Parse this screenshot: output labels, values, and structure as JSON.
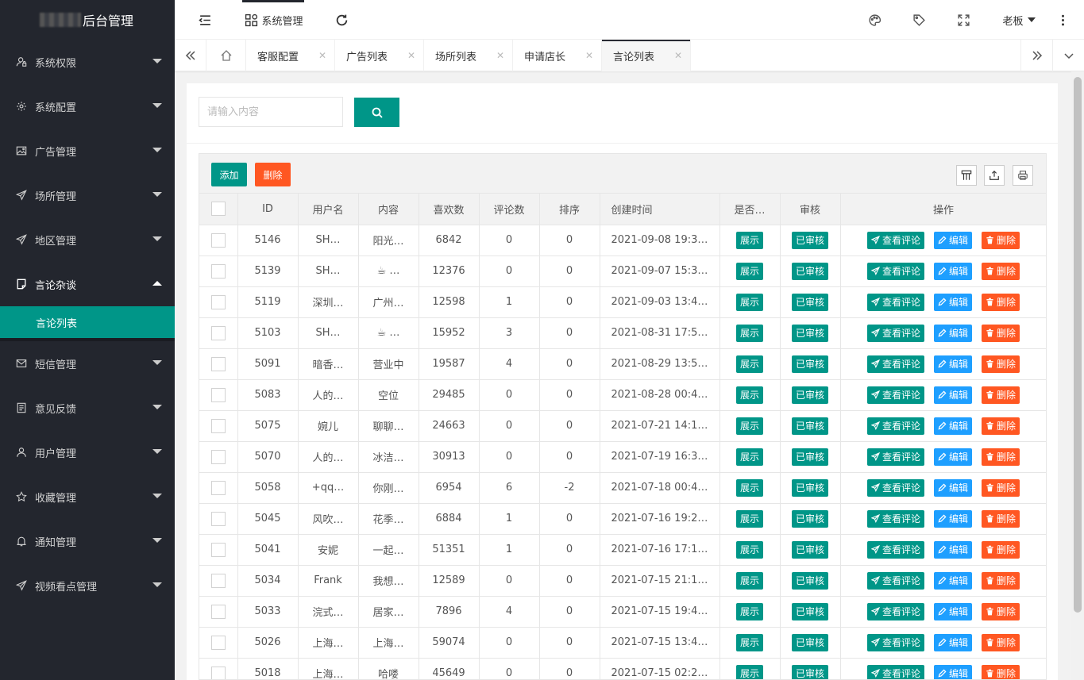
{
  "brand": {
    "title": "后台管理"
  },
  "sidebar": {
    "items": [
      {
        "label": "系统权限",
        "icon": "user-lock-icon"
      },
      {
        "label": "系统配置",
        "icon": "gear-icon"
      },
      {
        "label": "广告管理",
        "icon": "image-icon"
      },
      {
        "label": "场所管理",
        "icon": "send-icon"
      },
      {
        "label": "地区管理",
        "icon": "send-icon"
      },
      {
        "label": "言论杂谈",
        "icon": "note-icon",
        "open": true,
        "sub": [
          {
            "label": "言论列表",
            "active": true
          }
        ]
      },
      {
        "label": "短信管理",
        "icon": "mail-icon"
      },
      {
        "label": "意见反馈",
        "icon": "list-icon"
      },
      {
        "label": "用户管理",
        "icon": "user-icon"
      },
      {
        "label": "收藏管理",
        "icon": "star-icon"
      },
      {
        "label": "通知管理",
        "icon": "bell-icon"
      },
      {
        "label": "视频看点管理",
        "icon": "send-icon"
      }
    ]
  },
  "header": {
    "system_label": "系统管理",
    "user_label": "老板"
  },
  "tabs": [
    {
      "label": "客服配置"
    },
    {
      "label": "广告列表"
    },
    {
      "label": "场所列表"
    },
    {
      "label": "申请店长"
    },
    {
      "label": "言论列表",
      "active": true
    }
  ],
  "search": {
    "placeholder": "请输入内容"
  },
  "toolbar": {
    "add_label": "添加",
    "delete_label": "删除"
  },
  "table": {
    "headers": [
      "ID",
      "用户名",
      "内容",
      "喜欢数",
      "评论数",
      "排序",
      "创建时间",
      "是否…",
      "审核",
      "操作"
    ],
    "action_labels": {
      "show": "展示",
      "reviewed": "已审核",
      "view_comments": "查看评论",
      "edit": "编辑",
      "delete": "删除"
    },
    "rows": [
      {
        "id": "5146",
        "user": "SH…",
        "content": "阳光…",
        "likes": "6842",
        "comments": "0",
        "sort": "0",
        "created": "2021-09-08 19:3…"
      },
      {
        "id": "5139",
        "user": "SH…",
        "content": "☕ …",
        "likes": "12376",
        "comments": "0",
        "sort": "0",
        "created": "2021-09-07 15:3…"
      },
      {
        "id": "5119",
        "user": "深圳…",
        "content": "广州…",
        "likes": "12598",
        "comments": "1",
        "sort": "0",
        "created": "2021-09-03 13:4…"
      },
      {
        "id": "5103",
        "user": "SH…",
        "content": "☕ …",
        "likes": "15952",
        "comments": "3",
        "sort": "0",
        "created": "2021-08-31 17:5…"
      },
      {
        "id": "5091",
        "user": "暗香…",
        "content": "营业中",
        "likes": "19587",
        "comments": "4",
        "sort": "0",
        "created": "2021-08-29 13:5…"
      },
      {
        "id": "5083",
        "user": "人的…",
        "content": "空位",
        "likes": "29485",
        "comments": "0",
        "sort": "0",
        "created": "2021-08-28 00:4…"
      },
      {
        "id": "5075",
        "user": "婉儿",
        "content": "聊聊…",
        "likes": "24663",
        "comments": "0",
        "sort": "0",
        "created": "2021-07-21 14:1…"
      },
      {
        "id": "5070",
        "user": "人的…",
        "content": "冰洁…",
        "likes": "30913",
        "comments": "0",
        "sort": "0",
        "created": "2021-07-19 16:3…"
      },
      {
        "id": "5058",
        "user": "+qq…",
        "content": "你刚…",
        "likes": "6954",
        "comments": "6",
        "sort": "-2",
        "created": "2021-07-18 00:4…"
      },
      {
        "id": "5045",
        "user": "风吹…",
        "content": "花季…",
        "likes": "6884",
        "comments": "1",
        "sort": "0",
        "created": "2021-07-16 19:2…"
      },
      {
        "id": "5041",
        "user": "安妮",
        "content": "一起…",
        "likes": "51351",
        "comments": "1",
        "sort": "0",
        "created": "2021-07-16 17:1…"
      },
      {
        "id": "5034",
        "user": "Frank",
        "content": "我想…",
        "likes": "12589",
        "comments": "0",
        "sort": "0",
        "created": "2021-07-15 21:1…"
      },
      {
        "id": "5033",
        "user": "浣式…",
        "content": "居家…",
        "likes": "7896",
        "comments": "4",
        "sort": "0",
        "created": "2021-07-15 19:4…"
      },
      {
        "id": "5026",
        "user": "上海…",
        "content": "上海…",
        "likes": "59074",
        "comments": "0",
        "sort": "0",
        "created": "2021-07-15 13:4…"
      },
      {
        "id": "5018",
        "user": "上海…",
        "content": "哈喽",
        "likes": "45649",
        "comments": "0",
        "sort": "0",
        "created": "2021-07-15 02:2…"
      }
    ]
  },
  "colors": {
    "primary": "#009688",
    "danger": "#ff5722",
    "info": "#1e9fff",
    "sidebar_bg": "#23262e"
  }
}
